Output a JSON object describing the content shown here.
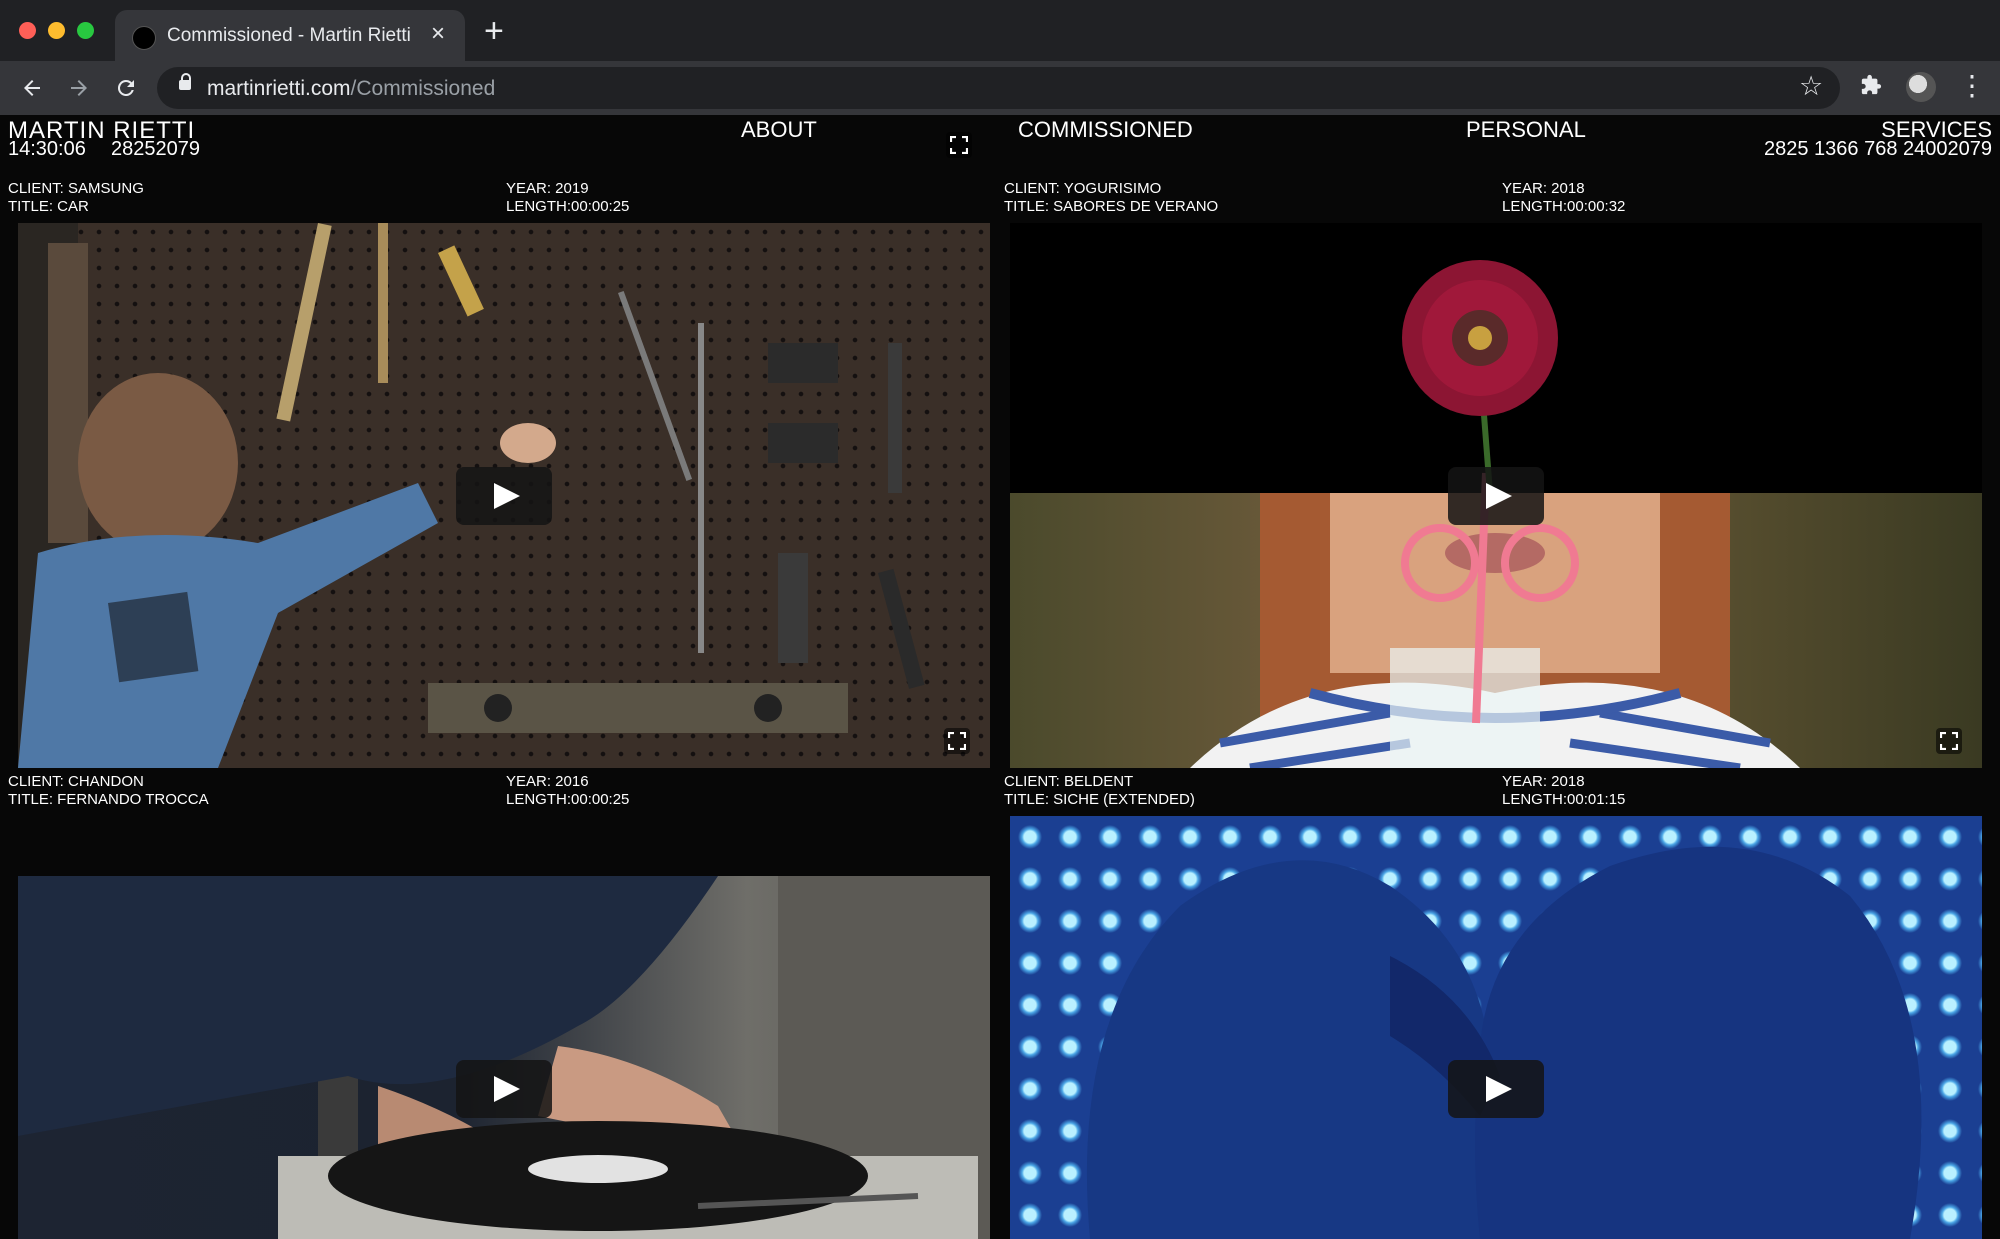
{
  "browser": {
    "tab_title": "Commissioned - Martin Rietti",
    "tab_close": "×",
    "new_tab": "+",
    "url_domain": "martinrietti.com",
    "url_path": "/Commissioned",
    "icons": [
      "back-arrow-icon",
      "forward-arrow-icon",
      "reload-icon",
      "lock-icon",
      "star-icon",
      "puzzle-icon",
      "avatar",
      "kebab-menu-icon"
    ]
  },
  "header": {
    "brand": "MARTIN RIETTI",
    "clock": "14:30:06",
    "counter_left": "28252079",
    "nav": {
      "about": "ABOUT",
      "commissioned": "COMMISSIONED",
      "personal": "PERSONAL",
      "services": "SERVICES"
    },
    "counter_right": "2825 1366 768 24002079"
  },
  "projects": [
    {
      "client": "CLIENT: SAMSUNG",
      "title": "TITLE: CAR",
      "year": "YEAR: 2019",
      "length": "LENGTH:00:00:25"
    },
    {
      "client": "CLIENT: YOGURISIMO",
      "title": "TITLE: SABORES DE VERANO",
      "year": "YEAR: 2018",
      "length": "LENGTH:00:00:32"
    },
    {
      "client": "CLIENT: CHANDON",
      "title": "TITLE: FERNANDO TROCCA",
      "year": "YEAR: 2016",
      "length": "LENGTH:00:00:25"
    },
    {
      "client": "CLIENT: BELDENT",
      "title": "TITLE: SICHE (EXTENDED)",
      "year": "YEAR: 2018",
      "length": "LENGTH:00:01:15"
    }
  ]
}
